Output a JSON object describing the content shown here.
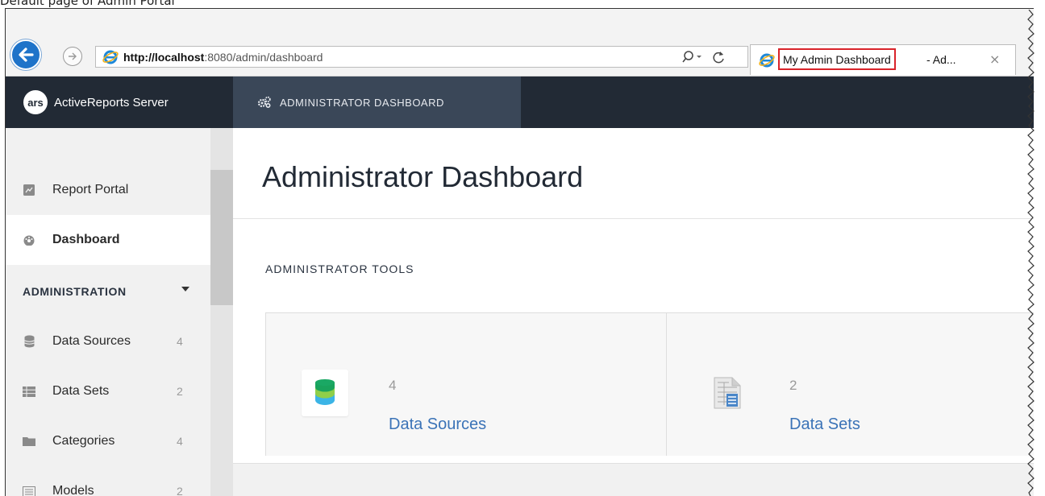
{
  "caption": "Default page of Admin Portal",
  "browser": {
    "url_host": "http://localhost",
    "url_rest": ":8080/admin/dashboard",
    "tab_title": "My Admin Dashboard",
    "tab_suffix": "- Ad...",
    "tab_close": "×",
    "highlight_color": "#d9232a"
  },
  "header": {
    "logo_text": "ars",
    "brand": "ActiveReports Server",
    "nav_tab": "ADMINISTRATOR DASHBOARD",
    "bg_color": "#222a35",
    "active_tab_color": "#3a4758"
  },
  "sidebar": {
    "items": [
      {
        "label": "Report Portal",
        "icon": "image-icon"
      },
      {
        "label": "Dashboard",
        "icon": "dashboard-gauge-icon"
      }
    ],
    "section": "ADMINISTRATION",
    "admin_items": [
      {
        "label": "Data Sources",
        "count": "4",
        "icon": "database-icon"
      },
      {
        "label": "Data Sets",
        "count": "2",
        "icon": "dataset-icon"
      },
      {
        "label": "Categories",
        "count": "4",
        "icon": "folder-icon"
      },
      {
        "label": "Models",
        "count": "2",
        "icon": "model-icon"
      }
    ]
  },
  "main": {
    "title": "Administrator Dashboard",
    "section": "ADMINISTRATOR TOOLS",
    "tiles": [
      {
        "count": "4",
        "label": "Data Sources",
        "icon": "database-stack-icon"
      },
      {
        "count": "2",
        "label": "Data Sets",
        "icon": "dataset-document-icon"
      }
    ],
    "link_color": "#3b73b7"
  }
}
